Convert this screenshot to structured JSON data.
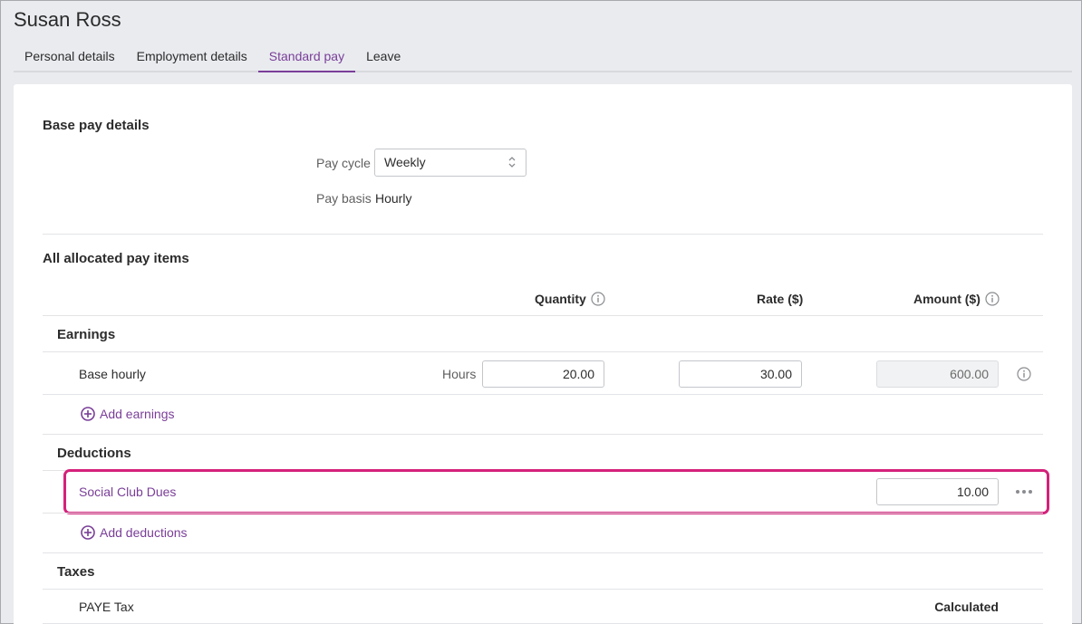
{
  "page": {
    "title": "Susan Ross"
  },
  "tabs": [
    {
      "label": "Personal details",
      "active": false
    },
    {
      "label": "Employment details",
      "active": false
    },
    {
      "label": "Standard pay",
      "active": true
    },
    {
      "label": "Leave",
      "active": false
    }
  ],
  "base_pay": {
    "title": "Base pay details",
    "pay_cycle_label": "Pay cycle",
    "pay_cycle_value": "Weekly",
    "pay_basis_label": "Pay basis",
    "pay_basis_value": "Hourly"
  },
  "pay_items": {
    "title": "All allocated pay items",
    "columns": {
      "quantity": "Quantity",
      "rate": "Rate ($)",
      "amount": "Amount ($)"
    },
    "earnings": {
      "title": "Earnings",
      "rows": [
        {
          "label": "Base hourly",
          "unit": "Hours",
          "quantity": "20.00",
          "rate": "30.00",
          "amount": "600.00"
        }
      ],
      "add_label": "Add earnings"
    },
    "deductions": {
      "title": "Deductions",
      "rows": [
        {
          "label": "Social Club Dues",
          "amount": "10.00"
        }
      ],
      "add_label": "Add deductions"
    },
    "taxes": {
      "title": "Taxes",
      "rows": [
        {
          "label": "PAYE Tax",
          "amount": "Calculated"
        }
      ]
    }
  },
  "colors": {
    "accent": "#7a3e98",
    "highlight": "#d4217a"
  }
}
